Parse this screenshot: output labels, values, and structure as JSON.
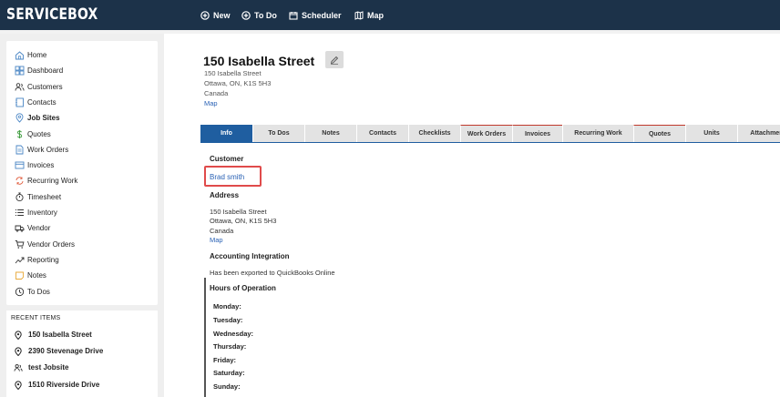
{
  "app": {
    "logo": "SERVICEBOX"
  },
  "topnav": [
    {
      "label": "New",
      "icon": "plus-circle-icon"
    },
    {
      "label": "To Do",
      "icon": "plus-circle-icon"
    },
    {
      "label": "Scheduler",
      "icon": "calendar-icon"
    },
    {
      "label": "Map",
      "icon": "map-icon"
    }
  ],
  "sidebar": {
    "items": [
      {
        "label": "Home",
        "icon": "home-icon"
      },
      {
        "label": "Dashboard",
        "icon": "dashboard-icon"
      },
      {
        "label": "Customers",
        "icon": "customers-icon"
      },
      {
        "label": "Contacts",
        "icon": "contacts-icon"
      },
      {
        "label": "Job Sites",
        "icon": "location-pin-icon",
        "active": true
      },
      {
        "label": "Quotes",
        "icon": "dollar-icon"
      },
      {
        "label": "Work Orders",
        "icon": "document-icon"
      },
      {
        "label": "Invoices",
        "icon": "invoice-icon"
      },
      {
        "label": "Recurring Work",
        "icon": "recurring-icon"
      },
      {
        "label": "Timesheet",
        "icon": "stopwatch-icon"
      },
      {
        "label": "Inventory",
        "icon": "list-icon"
      },
      {
        "label": "Vendor",
        "icon": "truck-icon"
      },
      {
        "label": "Vendor Orders",
        "icon": "cart-icon"
      },
      {
        "label": "Reporting",
        "icon": "trend-icon"
      },
      {
        "label": "Notes",
        "icon": "note-icon"
      },
      {
        "label": "To Dos",
        "icon": "clock-icon"
      }
    ]
  },
  "recent": {
    "title": "RECENT ITEMS",
    "items": [
      {
        "label": "150 Isabella Street",
        "icon": "location-pin-icon"
      },
      {
        "label": "2390 Stevenage Drive",
        "icon": "location-pin-icon"
      },
      {
        "label": "test Jobsite",
        "icon": "customers-icon"
      },
      {
        "label": "1510 Riverside Drive",
        "icon": "location-pin-icon"
      }
    ]
  },
  "page": {
    "title": "150 Isabella Street",
    "address_line1": "150 Isabella Street",
    "address_line2": "Ottawa, ON, K1S 5H3",
    "address_line3": "Canada",
    "map_link": "Map"
  },
  "tabs": [
    {
      "label": "Info",
      "active": true
    },
    {
      "label": "To Dos"
    },
    {
      "label": "Notes"
    },
    {
      "label": "Contacts"
    },
    {
      "label": "Checklists"
    },
    {
      "label": "Work Orders",
      "flag": true
    },
    {
      "label": "Invoices",
      "flag": true
    },
    {
      "label": "Recurring Work"
    },
    {
      "label": "Quotes",
      "flag": true
    },
    {
      "label": "Units"
    },
    {
      "label": "Attachments"
    }
  ],
  "info": {
    "customer_heading": "Customer",
    "customer_name": "Brad smith",
    "address_heading": "Address",
    "address_line1": "150 Isabella Street",
    "address_line2": "Ottawa, ON, K1S 5H3",
    "address_line3": "Canada",
    "address_map": "Map",
    "accounting_heading": "Accounting Integration",
    "accounting_text": "Has been exported to QuickBooks Online",
    "hours_heading": "Hours of Operation",
    "days": [
      "Monday:",
      "Tuesday:",
      "Wednesday:",
      "Thursday:",
      "Friday:",
      "Saturday:",
      "Sunday:"
    ]
  },
  "colors": {
    "topbar": "#1c3249",
    "active_tab": "#1f5ea0",
    "link": "#2a62b5",
    "highlight": "#e04b4b"
  }
}
